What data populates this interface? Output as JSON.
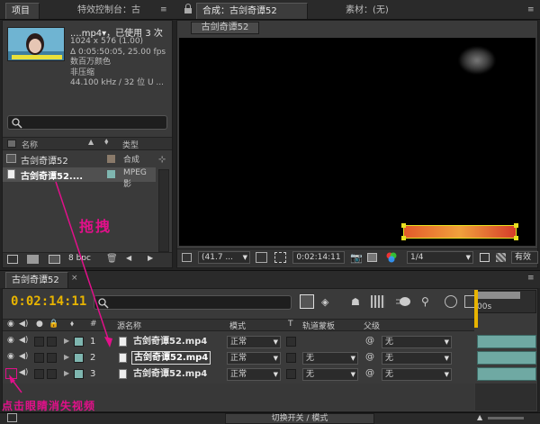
{
  "project_panel": {
    "tab_project": "项目",
    "tab_effects": "特效控制台：古",
    "thumb_title": "....mp4▾，已使用 3 次",
    "info_lines": [
      "1024 x 576 (1.00)",
      "Δ 0:05:50:05, 25.00 fps",
      "数百万颜色",
      "非压缩",
      "44.100 kHz / 32 位 U ..."
    ],
    "col_name": "名称",
    "col_type": "类型",
    "items": [
      {
        "name": "古剑奇谭52",
        "type": "合成",
        "color": "#8a7a6a"
      },
      {
        "name": "古剑奇谭52....",
        "type": "MPEG 影",
        "color": "#7fb6b0"
      }
    ],
    "bpc": "8 bpc"
  },
  "viewer": {
    "tab_comp": "合成：古剑奇谭52",
    "tab_footage": "素材：(无)",
    "comp_button": "古剑奇谭52",
    "zoom": "(41.7 ...",
    "timecode": "0:02:14:11",
    "resolution": "1/4",
    "active_label": "有效"
  },
  "timeline": {
    "tab": "古剑奇谭52",
    "timecode": "0:02:14:11",
    "col_index": "#",
    "col_source": "源名称",
    "col_mode": "模式",
    "col_t": "T",
    "col_trkmat": "轨道蒙板",
    "col_parent": "父级",
    "ruler_start": "00s",
    "layers": [
      {
        "num": "1",
        "name": "古剑奇谭52.mp4",
        "mode": "正常",
        "trkmat": "",
        "parent": "无"
      },
      {
        "num": "2",
        "name": "古剑奇谭52.mp4",
        "mode": "正常",
        "trkmat": "无",
        "parent": "无"
      },
      {
        "num": "3",
        "name": "古剑奇谭52.mp4",
        "mode": "正常",
        "trkmat": "无",
        "parent": "无"
      }
    ],
    "bottom_label": "切换开关 / 模式"
  },
  "annotations": {
    "drag_label": "拖拽",
    "click_label": "点击眼睛消失视频",
    "color": "#e2108a"
  }
}
